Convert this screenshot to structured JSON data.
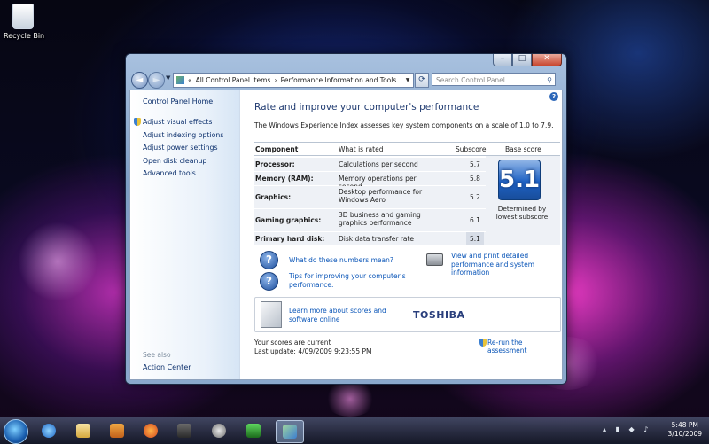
{
  "desktop": {
    "recycle_bin_label": "Recycle Bin"
  },
  "window": {
    "controls": {
      "minimize": "–",
      "maximize": "□",
      "close": "✕"
    },
    "address": {
      "overflow": "«",
      "crumb1": "All Control Panel Items",
      "separator": "›",
      "crumb2": "Performance Information and Tools"
    },
    "search_placeholder": "Search Control Panel",
    "help": "?"
  },
  "sidebar": {
    "home": "Control Panel Home",
    "tasks": [
      "Adjust visual effects",
      "Adjust indexing options",
      "Adjust power settings",
      "Open disk cleanup",
      "Advanced tools"
    ],
    "see_also": "See also",
    "action_center": "Action Center"
  },
  "main": {
    "title": "Rate and improve your computer's performance",
    "intro": "The Windows Experience Index assesses key system components on a scale of 1.0 to 7.9.",
    "headers": {
      "component": "Component",
      "rated": "What is rated",
      "subscore": "Subscore",
      "base": "Base score"
    },
    "rows": [
      {
        "component": "Processor:",
        "rated": "Calculations per second",
        "subscore": "5.7"
      },
      {
        "component": "Memory (RAM):",
        "rated": "Memory operations per second",
        "subscore": "5.8"
      },
      {
        "component": "Graphics:",
        "rated": "Desktop performance for Windows Aero",
        "subscore": "5.2"
      },
      {
        "component": "Gaming graphics:",
        "rated": "3D business and gaming graphics performance",
        "subscore": "6.1"
      },
      {
        "component": "Primary hard disk:",
        "rated": "Disk data transfer rate",
        "subscore": "5.1"
      }
    ],
    "base_score": "5.1",
    "base_caption": "Determined by lowest subscore",
    "links": {
      "numbers": "What do these numbers mean?",
      "tips": "Tips for improving your computer's performance.",
      "print": "View and print detailed performance and system information",
      "learn": "Learn more about scores and software online"
    },
    "toshiba": "TOSHIBA",
    "status_current": "Your scores are current",
    "last_update": "Last update: 4/09/2009 9:23:55 PM",
    "rerun": "Re-run the assessment"
  },
  "taskbar": {
    "time": "5:48 PM",
    "date": "3/10/2009",
    "apps": [
      "internet-explorer",
      "explorer",
      "media-player",
      "firefox",
      "game",
      "media-center",
      "game2",
      "control-panel"
    ],
    "tray_icons": "▴ ▮ ◆ ♪"
  }
}
